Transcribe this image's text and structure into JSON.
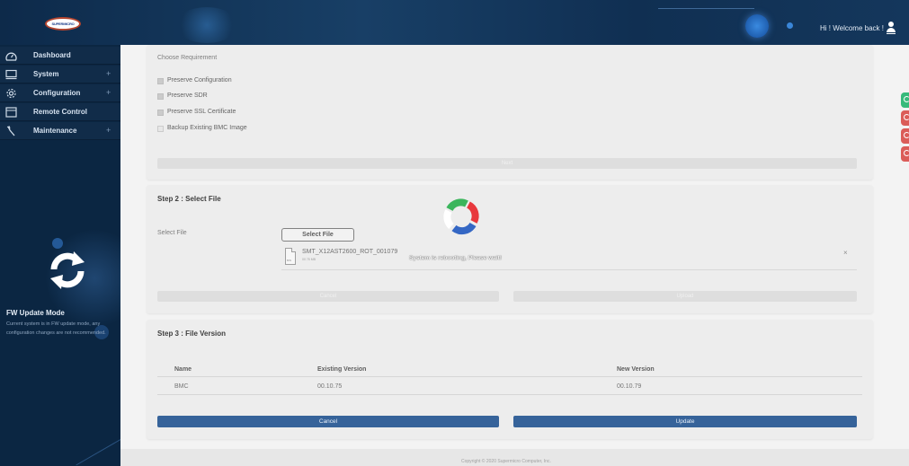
{
  "header": {
    "logo_text": "SUPERMICRO",
    "welcome": "Hi ! Welcome back !"
  },
  "sidebar": {
    "items": [
      {
        "label": "Dashboard",
        "icon": "dashboard-icon",
        "expandable": false
      },
      {
        "label": "System",
        "icon": "monitor-icon",
        "expandable": true
      },
      {
        "label": "Configuration",
        "icon": "gear-icon",
        "expandable": true
      },
      {
        "label": "Remote Control",
        "icon": "remote-control-icon",
        "expandable": false
      },
      {
        "label": "Maintenance",
        "icon": "wrench-icon",
        "expandable": true
      }
    ],
    "plus_symbol": "+",
    "fw_mode": {
      "title": "FW Update Mode",
      "description": "Current system is in FW update mode, any configuration changes are not recommended."
    }
  },
  "step1": {
    "title": "Choose Requirement",
    "options": [
      {
        "label": "Preserve Configuration",
        "checked": true
      },
      {
        "label": "Preserve SDR",
        "checked": true
      },
      {
        "label": "Preserve SSL Certificate",
        "checked": true
      },
      {
        "label": "Backup Existing BMC Image",
        "checked": false
      }
    ],
    "next_label": "Next"
  },
  "step2": {
    "title": "Step 2 : Select File",
    "field_label": "Select File",
    "select_button": "Select File",
    "file": {
      "name": "SMT_X12AST2600_ROT_001079",
      "size": "00 75 MB",
      "icon_label": "BIN",
      "remove_symbol": "×"
    },
    "cancel_label": "Cancel",
    "upload_label": "Upload"
  },
  "step3": {
    "title": "Step 3 : File Version",
    "columns": [
      "Name",
      "Existing Version",
      "New Version"
    ],
    "rows": [
      {
        "name": "BMC",
        "existing": "00.10.75",
        "new": "00.10.79"
      }
    ],
    "cancel_label": "Cancel",
    "update_label": "Update"
  },
  "overlay": {
    "message": "System is rebooting, Please wait!"
  },
  "footer": {
    "copyright": "Copyright © 2020 Supermicro Computer, Inc."
  },
  "colors": {
    "header_bg": "#14375c",
    "sidebar_bg": "#0b2642",
    "primary_button": "#2a5a94",
    "side_tab_green": "#2bb673",
    "side_tab_red": "#d9534f",
    "spinner": [
      "#3bb55c",
      "#e8383d",
      "#3467c4",
      "#ffffff"
    ]
  }
}
